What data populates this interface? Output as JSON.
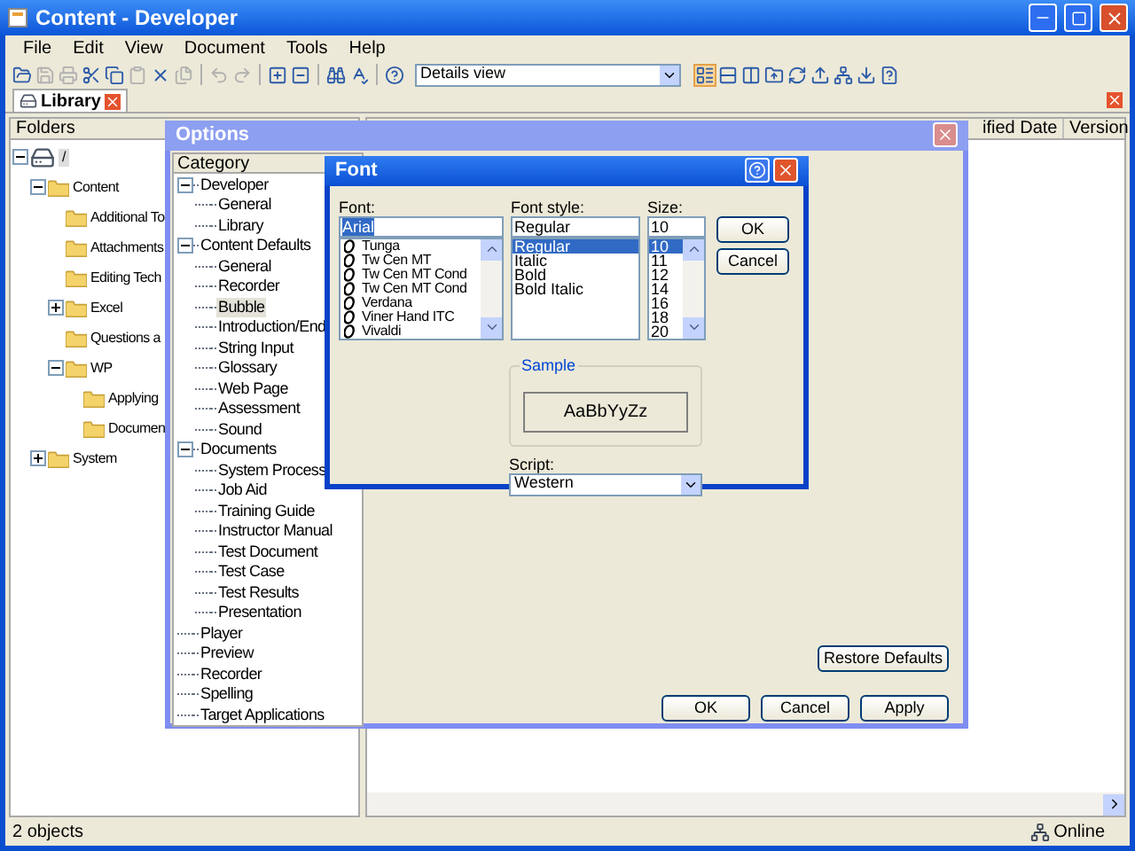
{
  "window": {
    "title": "Content - Developer"
  },
  "menu": [
    "File",
    "Edit",
    "View",
    "Document",
    "Tools",
    "Help"
  ],
  "toolbar": {
    "view_select": "Details view"
  },
  "tab": {
    "label": "Library"
  },
  "folders": {
    "header": "Folders",
    "tree": [
      {
        "label": "/",
        "kind": "root",
        "expanded": true,
        "children": [
          {
            "label": "Content",
            "expanded": true,
            "children": [
              {
                "label": "Additional To"
              },
              {
                "label": "Attachments"
              },
              {
                "label": "Editing Tech"
              },
              {
                "label": "Excel",
                "expanded": false
              },
              {
                "label": "Questions a"
              },
              {
                "label": "WP",
                "expanded": true,
                "children": [
                  {
                    "label": "Applying"
                  },
                  {
                    "label": "Documen"
                  }
                ]
              }
            ]
          },
          {
            "label": "System",
            "expanded": false
          }
        ]
      }
    ]
  },
  "list": {
    "columns": [
      "ified Date",
      "Version"
    ]
  },
  "options": {
    "title": "Options",
    "category_header": "Category",
    "tree": [
      {
        "label": "Developer",
        "selected": false,
        "children": [
          {
            "label": "General",
            "selected": false
          },
          {
            "label": "Library",
            "selected": false
          }
        ]
      },
      {
        "label": "Content Defaults",
        "selected": false,
        "children": [
          {
            "label": "General",
            "selected": false
          },
          {
            "label": "Recorder",
            "selected": false
          },
          {
            "label": "Bubble",
            "selected": true
          },
          {
            "label": "Introduction/End",
            "selected": false
          },
          {
            "label": "String Input",
            "selected": false
          },
          {
            "label": "Glossary",
            "selected": false
          },
          {
            "label": "Web Page",
            "selected": false
          },
          {
            "label": "Assessment",
            "selected": false
          },
          {
            "label": "Sound",
            "selected": false
          }
        ]
      },
      {
        "label": "Documents",
        "selected": false,
        "children": [
          {
            "label": "System Process",
            "selected": false
          },
          {
            "label": "Job Aid",
            "selected": false
          },
          {
            "label": "Training Guide",
            "selected": false
          },
          {
            "label": "Instructor Manual",
            "selected": false
          },
          {
            "label": "Test Document",
            "selected": false
          },
          {
            "label": "Test Case",
            "selected": false
          },
          {
            "label": "Test Results",
            "selected": false
          },
          {
            "label": "Presentation",
            "selected": false
          }
        ]
      },
      {
        "label": "Player",
        "selected": false
      },
      {
        "label": "Preview",
        "selected": false
      },
      {
        "label": "Recorder",
        "selected": false
      },
      {
        "label": "Spelling",
        "selected": false
      },
      {
        "label": "Target Applications",
        "selected": false
      }
    ],
    "restore_button": "Restore Defaults",
    "buttons": [
      "OK",
      "Cancel",
      "Apply"
    ]
  },
  "font_dialog": {
    "title": "Font",
    "font": {
      "label": "Font:",
      "value": "Arial",
      "items": [
        {
          "label": "Tunga",
          "selected": false
        },
        {
          "label": "Tw Cen MT",
          "selected": false
        },
        {
          "label": "Tw Cen MT Cond",
          "selected": false
        },
        {
          "label": "Tw Cen MT Cond",
          "selected": false
        },
        {
          "label": "Verdana",
          "selected": false
        },
        {
          "label": "Viner Hand ITC",
          "selected": false
        },
        {
          "label": "Vivaldi",
          "selected": false
        }
      ]
    },
    "style": {
      "label": "Font style:",
      "value": "Regular",
      "items": [
        {
          "label": "Regular",
          "selected": true
        },
        {
          "label": "Italic",
          "selected": false
        },
        {
          "label": "Bold",
          "selected": false
        },
        {
          "label": "Bold Italic",
          "selected": false
        }
      ]
    },
    "size": {
      "label": "Size:",
      "value": "10",
      "items": [
        {
          "label": "10",
          "selected": true
        },
        {
          "label": "11",
          "selected": false
        },
        {
          "label": "12",
          "selected": false
        },
        {
          "label": "14",
          "selected": false
        },
        {
          "label": "16",
          "selected": false
        },
        {
          "label": "18",
          "selected": false
        },
        {
          "label": "20",
          "selected": false
        }
      ]
    },
    "buttons": [
      "OK",
      "Cancel"
    ],
    "sample": {
      "label": "Sample",
      "text": "AaBbYyZz"
    },
    "script": {
      "label": "Script:",
      "value": "Western"
    }
  },
  "status_bar": {
    "left": "2 objects",
    "right": "Online"
  }
}
